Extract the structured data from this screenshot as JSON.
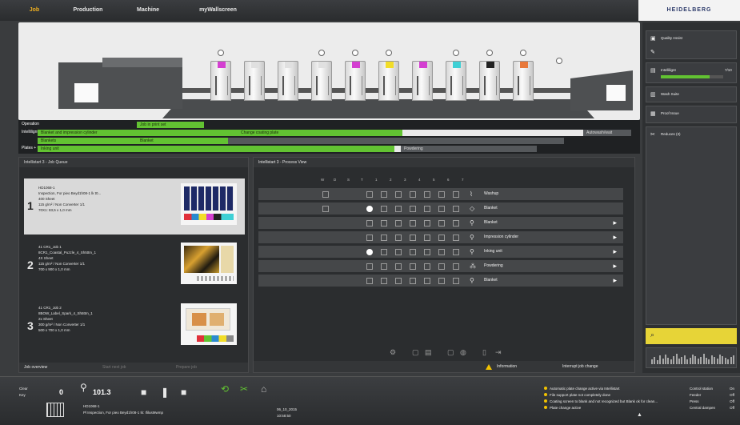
{
  "topnav": {
    "home_label": "Job",
    "tabs": [
      "Production",
      "Machine",
      "myWallscreen"
    ],
    "brand": "HEIDELBERG"
  },
  "status": {
    "rows": [
      {
        "label": "Operation",
        "segments": [
          "Job in print set"
        ]
      },
      {
        "label": "Intellilignt",
        "segments": [
          "Blanket and impression cylinder",
          "Change coating plate",
          "Autowash/wait"
        ]
      },
      {
        "label": "",
        "segments": [
          "Blankets",
          "Blanket"
        ]
      },
      {
        "label": "Plates + CC",
        "segments": [
          "Inking unit",
          "Powdering"
        ]
      }
    ]
  },
  "joblist": {
    "header": "Intellistart 3 - Job Queue",
    "jobs": [
      {
        "num": "1",
        "lines": [
          "HD1068-1",
          "Inspection, For pieo Beyd1h08-1 lk t0...",
          "400 Sheet",
          "115 g/m² / Non Converter 1/1",
          "70X1: 83,5 x 1,0 mm"
        ]
      },
      {
        "num": "2",
        "lines": [
          "41 CR1_Job 1",
          "8CR1_Coastal_Puzzle_4_Sh5ttm_1",
          "4X Sheet",
          "115 g/m² / Non Converter 1/1",
          "700 x 900 x 1,0 mm"
        ]
      },
      {
        "num": "3",
        "lines": [
          "41 CR1_Job 2",
          "8BOW_Label_Spark_4_Sh5ttm_1",
          "2x Sheet",
          "300 g/m² / Non Converter 1/1",
          "500 x 700 x 1,0 mm"
        ]
      }
    ],
    "footer": [
      "Job overview",
      "Start next job",
      "Prepare job"
    ]
  },
  "matrix": {
    "header": "Intellistart 3 - Process View",
    "col_heads": [
      "W",
      "D",
      "S",
      "T",
      "1",
      "2",
      "3",
      "4",
      "5",
      "6",
      "7"
    ],
    "rows": [
      {
        "label": "Washup",
        "icon": "wash-icon",
        "chevron": false,
        "first_checked": true,
        "filled_dot": false
      },
      {
        "label": "Blanket",
        "icon": "blanket-icon",
        "chevron": false,
        "first_checked": true,
        "filled_dot": true
      },
      {
        "label": "Blanket",
        "icon": "wrench-icon",
        "chevron": true,
        "first_checked": false,
        "filled_dot": false
      },
      {
        "label": "Impression cylinder",
        "icon": "wrench-icon",
        "chevron": true,
        "first_checked": false,
        "filled_dot": false
      },
      {
        "label": "Inking unit",
        "icon": "wrench-icon",
        "chevron": true,
        "first_checked": false,
        "filled_dot": true
      },
      {
        "label": "Powdering",
        "icon": "powder-icon",
        "chevron": true,
        "first_checked": false,
        "filled_dot": false
      },
      {
        "label": "Blanket",
        "icon": "wrench-icon",
        "chevron": true,
        "first_checked": false,
        "filled_dot": false
      }
    ],
    "footer_info": "Information",
    "footer_action": "Interrupt job change"
  },
  "sidebar": {
    "items": [
      {
        "label": "Quality Assist",
        "icon": "quality-icon"
      },
      {
        "label": "Intellilignt",
        "icon": "intelli-icon",
        "value": "7/10",
        "progress": 0.78
      },
      {
        "label": "Wash Suite",
        "icon": "wash-suite-icon"
      },
      {
        "label": "Proof Issue",
        "icon": "proof-icon"
      },
      {
        "label": "Reduces (3)",
        "icon": "tool-icon"
      }
    ]
  },
  "bottombar": {
    "mode": "Clear",
    "submode": "Key",
    "counter_a": "0",
    "counter_b": "101.3",
    "job_id": "HD1068-1",
    "job_desc": "Pl Inspection, For pieo Beyd1h08-1 tk: IfilusMwmp",
    "date": "06_10_2015",
    "time": "10:58:50",
    "messages": [
      "Automatic plate change active via Intellistart",
      "File support plate not completely done",
      "Coating screen to blank and not recognized but Blank ok for clean...",
      "Plate change active"
    ],
    "kv": [
      {
        "k": "Control station",
        "v": "On"
      },
      {
        "k": "Feeder",
        "v": "Off"
      },
      {
        "k": "Press",
        "v": "Off"
      },
      {
        "k": "Central dampen",
        "v": "Off"
      }
    ]
  },
  "colors": {
    "accent_green": "#62c232",
    "brand_blue": "#2c3a6a",
    "warning_yellow": "#e7d437"
  }
}
